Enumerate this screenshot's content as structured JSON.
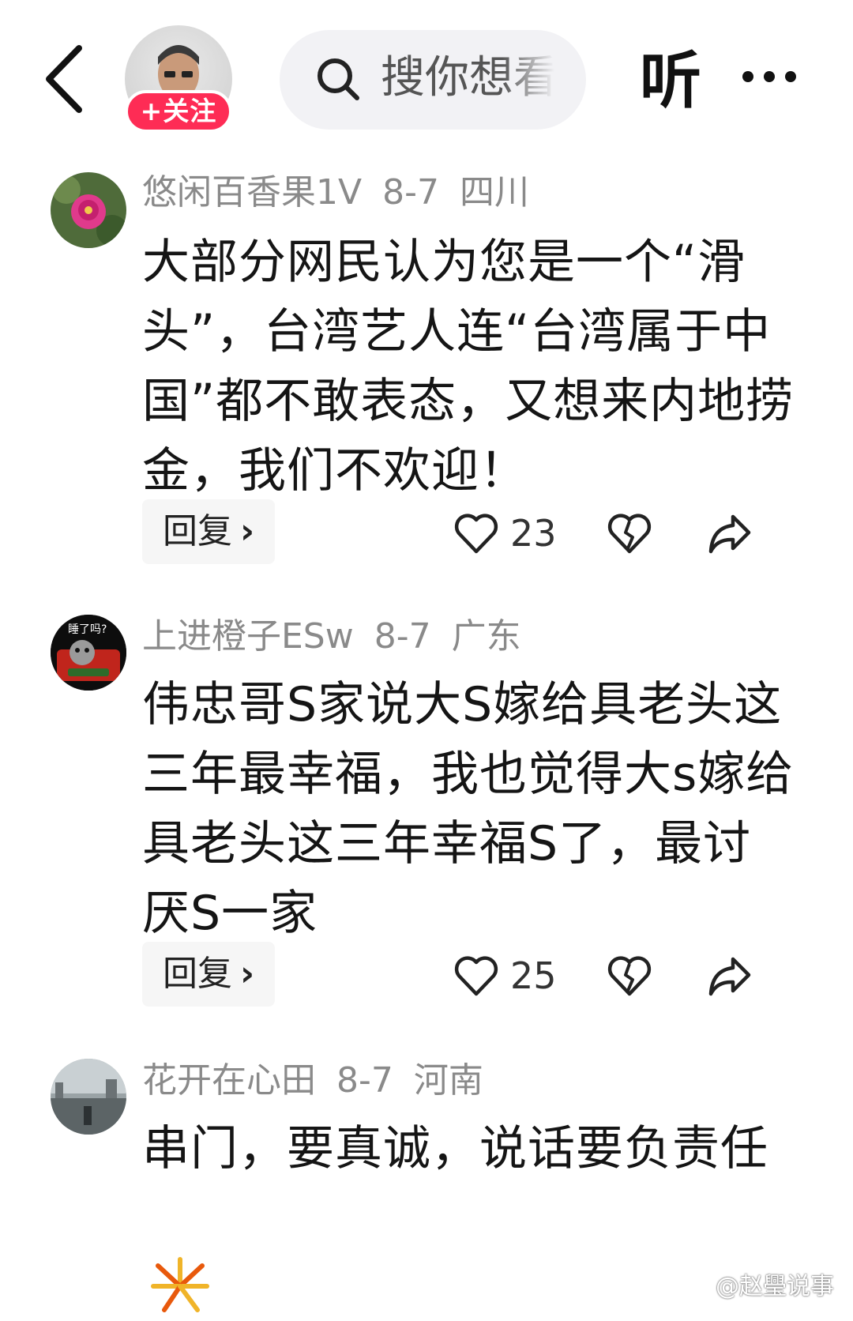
{
  "header": {
    "follow_label": "+关注",
    "search_placeholder": "搜你想看",
    "listen_label": "听"
  },
  "comments": [
    {
      "username": "悠闲百香果1V",
      "date": "8-7",
      "location": "四川",
      "text": "大部分网民认为您是一个“滑头”，台湾艺人连“台湾属于中国”都不敢表态，又想来内地捞金，我们不欢迎！",
      "reply_label": "回复",
      "likes": "23"
    },
    {
      "username": "上进橙子ESw",
      "date": "8-7",
      "location": "广东",
      "avatar_text": "睡了吗?",
      "text": "伟忠哥S家说大S嫁给具老头这三年最幸福，我也觉得大s嫁给具老头这三年幸福S了，最讨厌S一家",
      "reply_label": "回复",
      "likes": "25"
    },
    {
      "username": "花开在心田",
      "date": "8-7",
      "location": "河南",
      "text": "串门，要真诚，说话要负责任"
    }
  ],
  "watermark": "@赵璺说事",
  "colors": {
    "follow_red": "#fe2c55",
    "meta_gray": "#8a8a8a",
    "search_bg": "#f2f2f5"
  }
}
